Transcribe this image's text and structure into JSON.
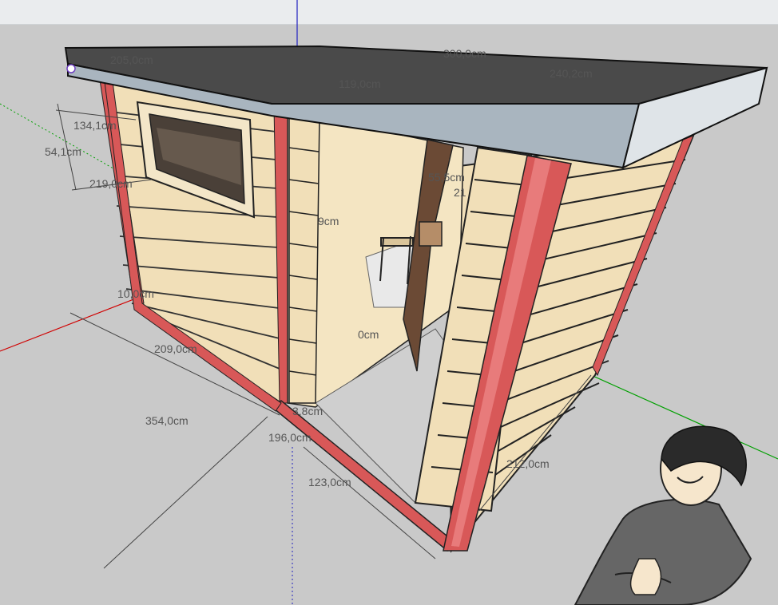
{
  "scene": {
    "colors": {
      "sky": "#eaecee",
      "ground": "#c9c9c9",
      "roof": "#4a4a4a",
      "fascia": "#a9b5bf",
      "wood": "#f1dfb8",
      "frame": "#d85858",
      "axis_red": "#d00000",
      "axis_green": "#00a000",
      "axis_blue": "#2020c0"
    },
    "dimensions": {
      "roof_left": "205,0cm",
      "roof_right": "300,0cm",
      "roof_front": "119,0cm",
      "roof_side": "240,2cm",
      "window_top": "134,1cm",
      "window_height": "54,1cm",
      "wall_height": "219,0cm",
      "base": "10,0cm",
      "side_depth": "209,0cm",
      "total_length": "354,0cm",
      "plank": "3,8cm",
      "front_width": "196,0cm",
      "door_width": "123,0cm",
      "right_height": "212,0cm",
      "inner_a": "55,5cm",
      "inner_b": "21",
      "inner_c": "9cm",
      "inner_d": "0cm"
    }
  }
}
